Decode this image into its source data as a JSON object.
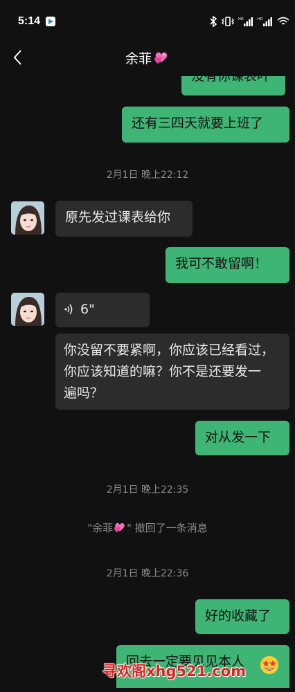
{
  "status_bar": {
    "time": "5:14",
    "icons": [
      "play-store-icon",
      "bluetooth-icon",
      "vibrate-icon",
      "signal-icon",
      "signal-icon",
      "wifi-icon"
    ]
  },
  "header": {
    "title": "余菲",
    "title_emoji": "two-hearts-emoji",
    "back_icon": "chevron-left-icon"
  },
  "messages": [
    {
      "type": "sent",
      "text": "没有你课表吖",
      "partial": true
    },
    {
      "type": "sent",
      "text": "还有三四天就要上班了"
    },
    {
      "type": "timestamp",
      "text": "2月1日 晚上22:12"
    },
    {
      "type": "recv",
      "text": "原先发过课表给你"
    },
    {
      "type": "sent",
      "text": "我可不敢留啊！"
    },
    {
      "type": "voice",
      "text": "6\""
    },
    {
      "type": "recv",
      "lines": [
        "你没留不要紧啊，你应该已经看过，",
        "你应该知道的嘛？你不是还要发一",
        "遍吗？"
      ]
    },
    {
      "type": "sent",
      "text": "对从发一下"
    },
    {
      "type": "timestamp",
      "text": "2月1日 晚上22:35"
    },
    {
      "type": "system",
      "prefix": "\"余菲",
      "suffix": "\" 撤回了一条消息"
    },
    {
      "type": "timestamp",
      "text": "2月1日 晚上22:36"
    },
    {
      "type": "sent",
      "text": "好的收藏了"
    },
    {
      "type": "sent",
      "text": "回去一定要见见本人",
      "partial": true
    }
  ],
  "watermark": {
    "text": "寻欢阁xhg521.com",
    "emoji": "star-struck-emoji"
  },
  "colors": {
    "background": "#111111",
    "sent_bubble": "#3eb575",
    "recv_bubble": "#2c2c2c",
    "timestamp_text": "#8a8a8a",
    "watermark": "#e02020"
  }
}
